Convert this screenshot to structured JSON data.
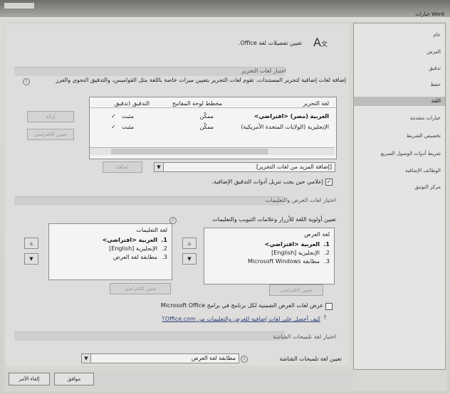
{
  "window": {
    "title": "خيارات Word"
  },
  "nav": {
    "items": [
      "عام",
      "العرض",
      "تدقيق",
      "حفظ",
      "اللغة",
      "خيارات متقدمة",
      "تخصيص الشريط",
      "شريط أدوات الوصول السريع",
      "الوظائف الإضافية",
      "مركز التوثيق"
    ],
    "selected": 4
  },
  "header": {
    "text": "تعيين تفضيلات لغة Office."
  },
  "editing": {
    "section": "اختيار لغات التحرير",
    "desc": "إضافة لغات إضافية لتحرير المستندات. تقوم لغات التحرير بتعيين ميزات خاصة باللغة مثل القواميس، والتدقيق النحوي والفرز",
    "cols": [
      "لغة التحرير",
      "مخطط لوحة المفاتيح",
      "التدقيق (تدقيق"
    ],
    "rows": [
      {
        "lang": "العربية (مصر) <افتراضي>",
        "kb": "ممكّن",
        "proof": "مثبت"
      },
      {
        "lang": "الإنجليزية (الولايات المتحدة الأمريكية)",
        "kb": "ممكّن",
        "proof": "مثبت"
      }
    ],
    "btn_remove": "إزالة",
    "btn_default": "تعيين كافتراضي",
    "btn_add": "إضافة",
    "add_combo": "[إضافة المزيد من لغات التحرير]",
    "notify": "إعلامي حين يجب تنزيل أدوات التدقيق الإضافية."
  },
  "display": {
    "section": "اختيار لغات العرض والتعليمات",
    "desc": "تعيين أولوية اللغة للأزرار وعلامات التبويب والتعليمات",
    "display_title": "لغة العرض",
    "display_items": [
      "العربية <افتراضي>",
      "الإنجليزية [English]",
      "مطابقة Microsoft Windows"
    ],
    "help_title": "لغة التعليمات",
    "help_items": [
      "العربية <افتراضي>",
      "الإنجليزية [English]",
      "مطابقة لغة العرض"
    ],
    "nums": [
      "1.",
      "2.",
      "3."
    ],
    "btn_default_display": "تعيين كافتراضي",
    "btn_default_help": "تعيين كافتراضي",
    "show_names": "عرض لغات العرض الضمنية لكل برنامج في برامج Microsoft Office",
    "link": "كيف أحصل على لغات إضافية للعرض والتعليمات من Office.com؟"
  },
  "screentip": {
    "section": "اختيار لغة تلميحات الشاشة",
    "label": "تعيين لغة تلميحات الشاشة",
    "value": "مطابقة لغة العرض"
  },
  "footer": {
    "ok": "موافق",
    "cancel": "إلغاء الأمر"
  }
}
